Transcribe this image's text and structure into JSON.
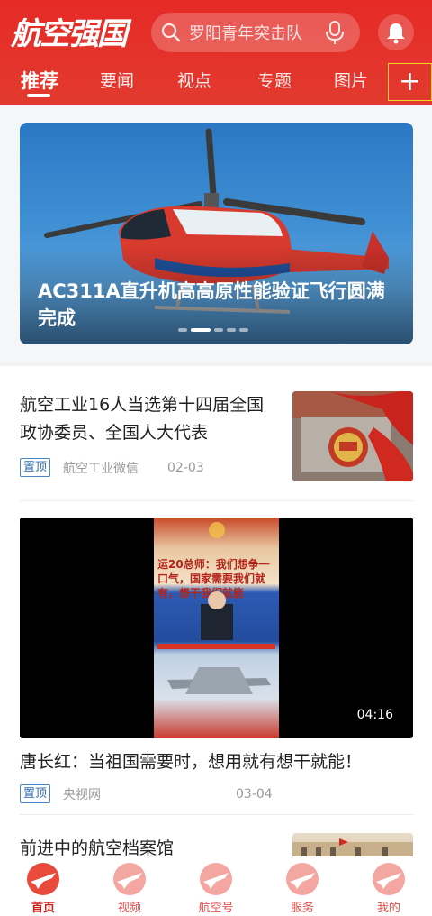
{
  "header": {
    "logo_text": "航空强国",
    "search": {
      "placeholder": "罗阳青年突击队"
    },
    "tabs": [
      {
        "label": "推荐",
        "active": true
      },
      {
        "label": "要闻",
        "active": false
      },
      {
        "label": "视点",
        "active": false
      },
      {
        "label": "专题",
        "active": false
      },
      {
        "label": "图片",
        "active": false
      }
    ],
    "add_label": "+"
  },
  "banner": {
    "title": "AC311A直升机高高原性能验证飞行圆满完成",
    "slides": 5,
    "active_slide": 2
  },
  "articles": [
    {
      "title": "航空工业16人当选第十四届全国政协委员、全国人大代表",
      "tag": "置顶",
      "source": "航空工业微信",
      "date": "02-03"
    },
    {
      "title": "唐长红：当祖国需要时，想用就有想干就能！",
      "tag": "置顶",
      "source": "央视网",
      "date": "03-04",
      "video_duration": "04:16",
      "video_caption": "运20总师：我们想争一口气，国家需要我们就有，想干我们就能"
    },
    {
      "title": "前进中的航空档案馆"
    }
  ],
  "bottom_nav": [
    {
      "label": "首页",
      "icon": "home-plane-icon",
      "active": true
    },
    {
      "label": "视频",
      "icon": "video-plane-icon",
      "active": false
    },
    {
      "label": "航空号",
      "icon": "aviation-account-icon",
      "active": false
    },
    {
      "label": "服务",
      "icon": "service-plane-icon",
      "active": false
    },
    {
      "label": "我的",
      "icon": "profile-plane-icon",
      "active": false
    }
  ],
  "colors": {
    "brand_red": "#e62a26",
    "tag_blue": "#2f6db0",
    "text_dark": "#222222",
    "text_muted": "#999999"
  }
}
